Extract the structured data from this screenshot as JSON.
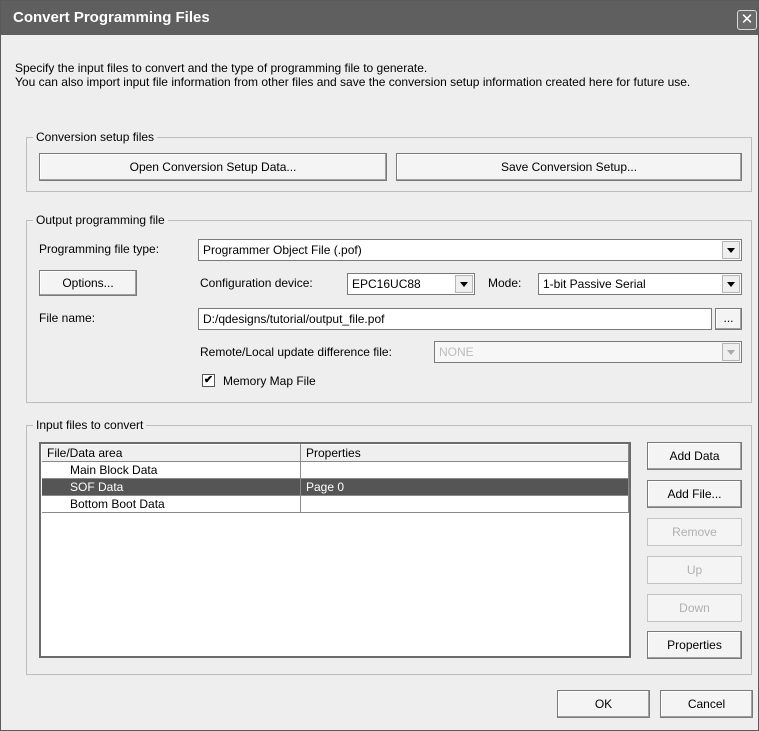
{
  "dialog": {
    "title": "Convert Programming Files",
    "close_glyph": "✕",
    "description": "Specify the input files to convert and the type of programming file to generate.\nYou can also import input file information from other files and save the conversion setup information created here for future use."
  },
  "conversion_setup": {
    "legend": "Conversion setup files",
    "open_button": "Open Conversion Setup Data...",
    "save_button": "Save Conversion Setup..."
  },
  "output": {
    "legend": "Output programming file",
    "file_type_label": "Programming file type:",
    "file_type_value": "Programmer Object File (.pof)",
    "options_button": "Options...",
    "config_device_label": "Configuration device:",
    "config_device_value": "EPC16UC88",
    "mode_label": "Mode:",
    "mode_value": "1-bit Passive Serial",
    "file_name_label": "File name:",
    "file_name_value": "D:/qdesigns/tutorial/output_file.pof",
    "browse_button": "...",
    "remote_label": "Remote/Local update difference file:",
    "remote_value": "NONE",
    "memory_map_label": "Memory Map File",
    "memory_map_checked": true,
    "checkmark": "✔"
  },
  "input": {
    "legend": "Input files to convert",
    "columns": [
      "File/Data area",
      "Properties"
    ],
    "rows": [
      {
        "name": "Main Block Data",
        "props": "",
        "selected": false
      },
      {
        "name": "SOF Data",
        "props": "Page 0",
        "selected": true
      },
      {
        "name": "Bottom Boot Data",
        "props": "",
        "selected": false
      }
    ],
    "buttons": {
      "add_data": "Add Data",
      "add_file": "Add File...",
      "remove": "Remove",
      "up": "Up",
      "down": "Down",
      "properties": "Properties"
    }
  },
  "footer": {
    "ok": "OK",
    "cancel": "Cancel"
  }
}
